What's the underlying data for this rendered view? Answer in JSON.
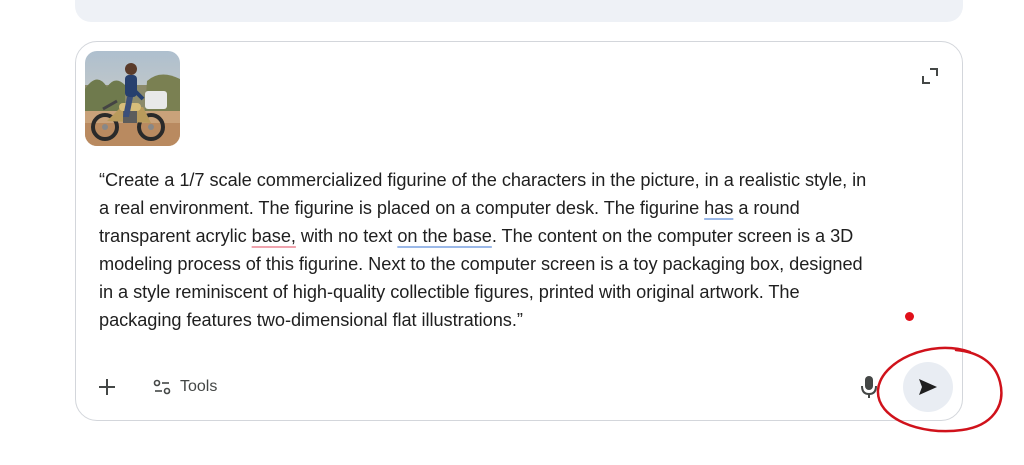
{
  "composer": {
    "prompt_lines": [
      [
        {
          "text": "“Create a 1/7 scale commercialized figurine of the characters in the picture, in a realistic style, in",
          "style": ""
        }
      ],
      [
        {
          "text": "a real environment. The figurine is placed on a computer desk. The figurine ",
          "style": ""
        },
        {
          "text": "has",
          "style": "u-blue"
        },
        {
          "text": " a round",
          "style": ""
        }
      ],
      [
        {
          "text": "transparent acrylic ",
          "style": ""
        },
        {
          "text": "base,",
          "style": "u-red"
        },
        {
          "text": " with no text ",
          "style": ""
        },
        {
          "text": "on the base",
          "style": "u-blue"
        },
        {
          "text": ". The content on the computer screen is a 3D",
          "style": ""
        }
      ],
      [
        {
          "text": "modeling process of this figurine. Next to the computer screen is a toy packaging box, designed",
          "style": ""
        }
      ],
      [
        {
          "text": "in a style reminiscent of high-quality collectible figures, printed with original artwork. The",
          "style": ""
        }
      ],
      [
        {
          "text": "packaging features two-dimensional flat illustrations.”",
          "style": ""
        }
      ]
    ],
    "attachment_icon": "photo-thumbnail",
    "expand_icon": "expand-icon"
  },
  "toolbar": {
    "add_icon": "plus-icon",
    "tools_icon": "tools-icon",
    "tools_label": "Tools",
    "mic_icon": "mic-icon",
    "send_icon": "send-icon"
  },
  "colors": {
    "border": "#d3d6db",
    "send_bg": "#e9edf3",
    "annotation": "#d0121b",
    "indicator": "#e0101a"
  }
}
